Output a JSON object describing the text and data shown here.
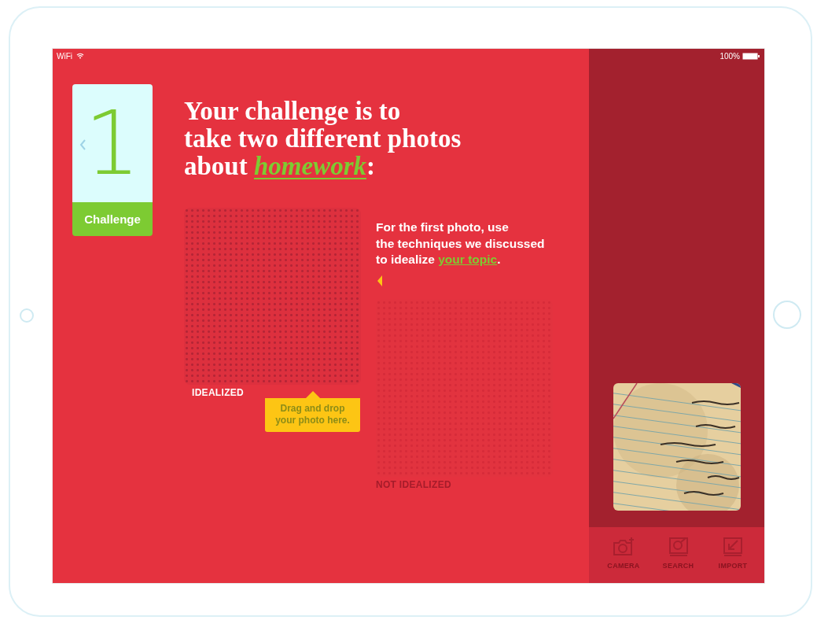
{
  "status_bar": {
    "network": "WiFi",
    "battery": "100%"
  },
  "challenge_card": {
    "number": "1",
    "label": "Challenge"
  },
  "headline": {
    "lines": [
      "Your challenge is to",
      "take two different photos",
      "about"
    ],
    "link": "homework",
    "after": ":"
  },
  "drop_zones": [
    {
      "label": "IDEALIZED",
      "active": true
    },
    {
      "label": "NOT IDEALIZED",
      "active": false
    }
  ],
  "tooltip": {
    "lines": [
      "Drag and drop",
      "your photo here."
    ]
  },
  "instruction": {
    "lines": [
      "For the first photo, use",
      "the techniques we discussed",
      "to idealize"
    ],
    "link": "your topic",
    "after": "."
  },
  "toolbar": [
    {
      "kind": "camera",
      "label": "CAMERA"
    },
    {
      "kind": "search",
      "label": "SEARCH"
    },
    {
      "kind": "import",
      "label": "IMPORT"
    }
  ]
}
